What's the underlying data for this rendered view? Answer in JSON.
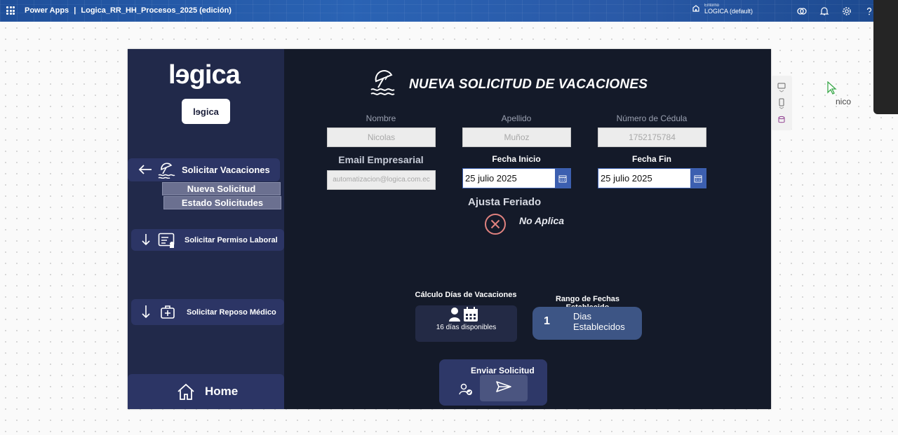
{
  "topbar": {
    "app_name": "Power Apps",
    "separator": "|",
    "doc_title": "Logica_RR_HH_Procesos_2025 (edición)",
    "env_label": "Entorno",
    "env_name": "LOGICA (default)"
  },
  "sidebar": {
    "logo_text": "lɘgica",
    "logo_chip_text": "lɘgica",
    "vacaciones_label": "Solicitar Vacaciones",
    "sub_nueva": "Nueva Solicitud",
    "sub_estado": "Estado Solicitudes",
    "permiso_label": "Solicitar Permiso Laboral",
    "reposo_label": "Solicitar Reposo Médico",
    "home_label": "Home"
  },
  "form": {
    "title": "NUEVA SOLICITUD DE VACACIONES",
    "nombre_label": "Nombre",
    "nombre_value": "Nicolas",
    "apellido_label": "Apellido",
    "apellido_value": "Muñoz",
    "cedula_label": "Número de Cédula",
    "cedula_value": "1752175784",
    "email_label": "Email Empresarial",
    "email_value": "automatizacion@logica.com.ec",
    "fecha_inicio_label": "Fecha Inicio",
    "fecha_inicio_value": "25 julio 2025",
    "fecha_fin_label": "Fecha Fin",
    "fecha_fin_value": "25 julio 2025",
    "feriado_label": "Ajusta Feriado",
    "feriado_value": "No Aplica",
    "calculo_label": "Cálculo Días de Vacaciones",
    "calculo_text": "16 días disponibles",
    "rango_label": "Rango de Fechas Establecido",
    "rango_num": "1",
    "rango_text_1": "Dias",
    "rango_text_2": "Establecidos",
    "send_label": "Enviar Solicitud"
  },
  "presence": {
    "cursor_name": "nico"
  },
  "colors": {
    "canvas_bg": "#141a29",
    "sidebar_bg": "#21294a",
    "nav_btn": "#2c3565",
    "date_accent": "#3c5fb0",
    "rango_bg": "#3d5585",
    "cancel_red": "#e0827f",
    "cursor_green": "#3aa84a"
  }
}
